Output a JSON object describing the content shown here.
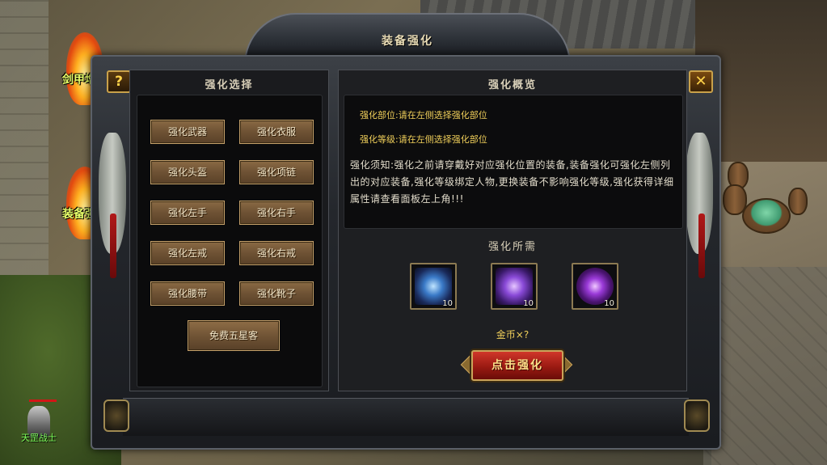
{
  "dialog": {
    "title": "装备强化",
    "help_symbol": "?",
    "close_symbol": "✕"
  },
  "left_panel": {
    "title": "强化选择",
    "buttons": [
      "强化武器",
      "强化衣服",
      "强化头盔",
      "强化项链",
      "强化左手",
      "强化右手",
      "强化左戒",
      "强化右戒",
      "强化腰带",
      "强化靴子"
    ],
    "free_button": "免费五星客"
  },
  "right_panel": {
    "title": "强化概览",
    "part_line": "强化部位:请在左侧选择强化部位",
    "level_line": "强化等级:请在左侧选择强化部位",
    "notice": "强化须知:强化之前请穿戴好对应强化位置的装备,装备强化可强化左侧列出的对应装备,强化等级绑定人物,更换装备不影响强化等级,强化获得详细属性请查看面板左上角!!!",
    "requirement_title": "强化所需",
    "items": [
      {
        "icon": "blue-weapon-icon",
        "count": "10"
      },
      {
        "icon": "purple-wand-icon",
        "count": "10"
      },
      {
        "icon": "purple-orb-icon",
        "count": "10"
      }
    ],
    "gold_text": "金币×?",
    "enhance_button": "点击强化"
  },
  "world": {
    "side_label_1": "剑甲增幅",
    "side_label_2": "装备强化",
    "character_name": "天罡战士"
  }
}
